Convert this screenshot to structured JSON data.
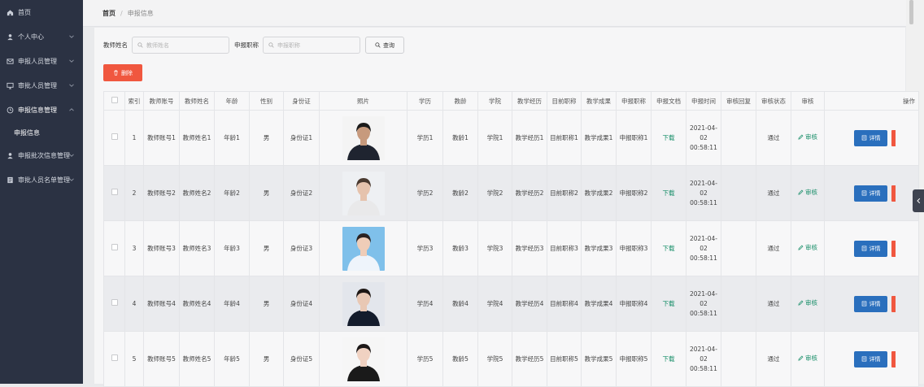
{
  "sidebar": {
    "items": [
      {
        "label": "首页",
        "icon": "home-icon",
        "chevron": false
      },
      {
        "label": "个人中心",
        "icon": "user-icon",
        "chevron": true
      },
      {
        "label": "申报人员管理",
        "icon": "mail-icon",
        "chevron": true
      },
      {
        "label": "审批人员管理",
        "icon": "monitor-icon",
        "chevron": true
      },
      {
        "label": "申报信息管理",
        "icon": "clock-icon",
        "chevron": true,
        "expanded": true
      },
      {
        "label": "申报批次信息管理",
        "icon": "user-icon",
        "chevron": true
      },
      {
        "label": "审批人员名单管理",
        "icon": "list-icon",
        "chevron": true
      }
    ],
    "sub_item": "申报信息"
  },
  "breadcrumb": {
    "home": "首页",
    "separator": "/",
    "current": "申报信息"
  },
  "search": {
    "teacher_name_label": "教师姓名",
    "teacher_name_placeholder": "教师姓名",
    "title_label": "申报职称",
    "title_placeholder": "申报职称",
    "query_label": "查询"
  },
  "delete_label": "删除",
  "table": {
    "headers": [
      "",
      "索引",
      "教师账号",
      "教师姓名",
      "年龄",
      "性别",
      "身份证",
      "照片",
      "学历",
      "教龄",
      "学院",
      "教学经历",
      "目前职称",
      "教学成果",
      "申报职称",
      "申报文档",
      "申报时间",
      "审核回复",
      "审核状态",
      "审核",
      "操作"
    ],
    "download_label": "下载",
    "review_label": "审核",
    "detail_label": "详情",
    "rows": [
      {
        "index": "1",
        "account": "教师账号1",
        "name": "教师姓名1",
        "age": "年龄1",
        "gender": "男",
        "id_card": "身份证1",
        "education": "学历1",
        "teaching_age": "教龄1",
        "college": "学院1",
        "experience": "教学经历1",
        "current_title": "目前职称1",
        "achievement": "教学成果1",
        "applied_title": "申报职称1",
        "time": "2021-04-02 00:58:11",
        "reply": "",
        "status": "通过"
      },
      {
        "index": "2",
        "account": "教师账号2",
        "name": "教师姓名2",
        "age": "年龄2",
        "gender": "男",
        "id_card": "身份证2",
        "education": "学历2",
        "teaching_age": "教龄2",
        "college": "学院2",
        "experience": "教学经历2",
        "current_title": "目前职称2",
        "achievement": "教学成果2",
        "applied_title": "申报职称2",
        "time": "2021-04-02 00:58:11",
        "reply": "",
        "status": "通过"
      },
      {
        "index": "3",
        "account": "教师账号3",
        "name": "教师姓名3",
        "age": "年龄3",
        "gender": "男",
        "id_card": "身份证3",
        "education": "学历3",
        "teaching_age": "教龄3",
        "college": "学院3",
        "experience": "教学经历3",
        "current_title": "目前职称3",
        "achievement": "教学成果3",
        "applied_title": "申报职称3",
        "time": "2021-04-02 00:58:11",
        "reply": "",
        "status": "通过"
      },
      {
        "index": "4",
        "account": "教师账号4",
        "name": "教师姓名4",
        "age": "年龄4",
        "gender": "男",
        "id_card": "身份证4",
        "education": "学历4",
        "teaching_age": "教龄4",
        "college": "学院4",
        "experience": "教学经历4",
        "current_title": "目前职称4",
        "achievement": "教学成果4",
        "applied_title": "申报职称4",
        "time": "2021-04-02 00:58:11",
        "reply": "",
        "status": "通过"
      },
      {
        "index": "5",
        "account": "教师账号5",
        "name": "教师姓名5",
        "age": "年龄5",
        "gender": "男",
        "id_card": "身份证5",
        "education": "学历5",
        "teaching_age": "教龄5",
        "college": "学院5",
        "experience": "教学经历5",
        "current_title": "目前职称5",
        "achievement": "教学成果5",
        "applied_title": "申报职称5",
        "time": "2021-04-02 00:58:11",
        "reply": "",
        "status": "通过"
      }
    ]
  },
  "colors": {
    "sidebar_bg": "#2b3243",
    "delete": "#f0573f",
    "detail": "#2a6fbd",
    "link": "#1a8f6a"
  }
}
